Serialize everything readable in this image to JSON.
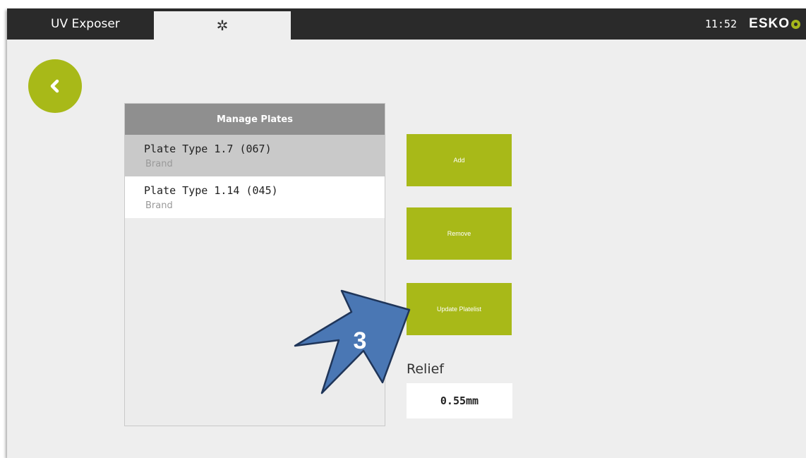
{
  "header": {
    "app_tab_label": "UV Exposer",
    "settings_tab_icon": "gear-icon",
    "time": "11:52",
    "brand": "ESKO"
  },
  "nav": {
    "back_icon": "chevron-left-icon"
  },
  "manage_plates": {
    "title": "Manage Plates",
    "items": [
      {
        "name": "Plate Type 1.7 (067)",
        "brand": "Brand",
        "selected": true
      },
      {
        "name": "Plate Type 1.14 (045)",
        "brand": "Brand",
        "selected": false
      }
    ]
  },
  "actions": {
    "add_label": "Add",
    "remove_label": "Remove",
    "update_label": "Update Platelist"
  },
  "relief": {
    "label": "Relief",
    "value": "0.55mm"
  },
  "callout": {
    "step_number": "3"
  },
  "colors": {
    "accent": "#a8b918",
    "topbar": "#2a2a2a",
    "background": "#eeeeee",
    "callout_arrow": "#4a77b4"
  }
}
